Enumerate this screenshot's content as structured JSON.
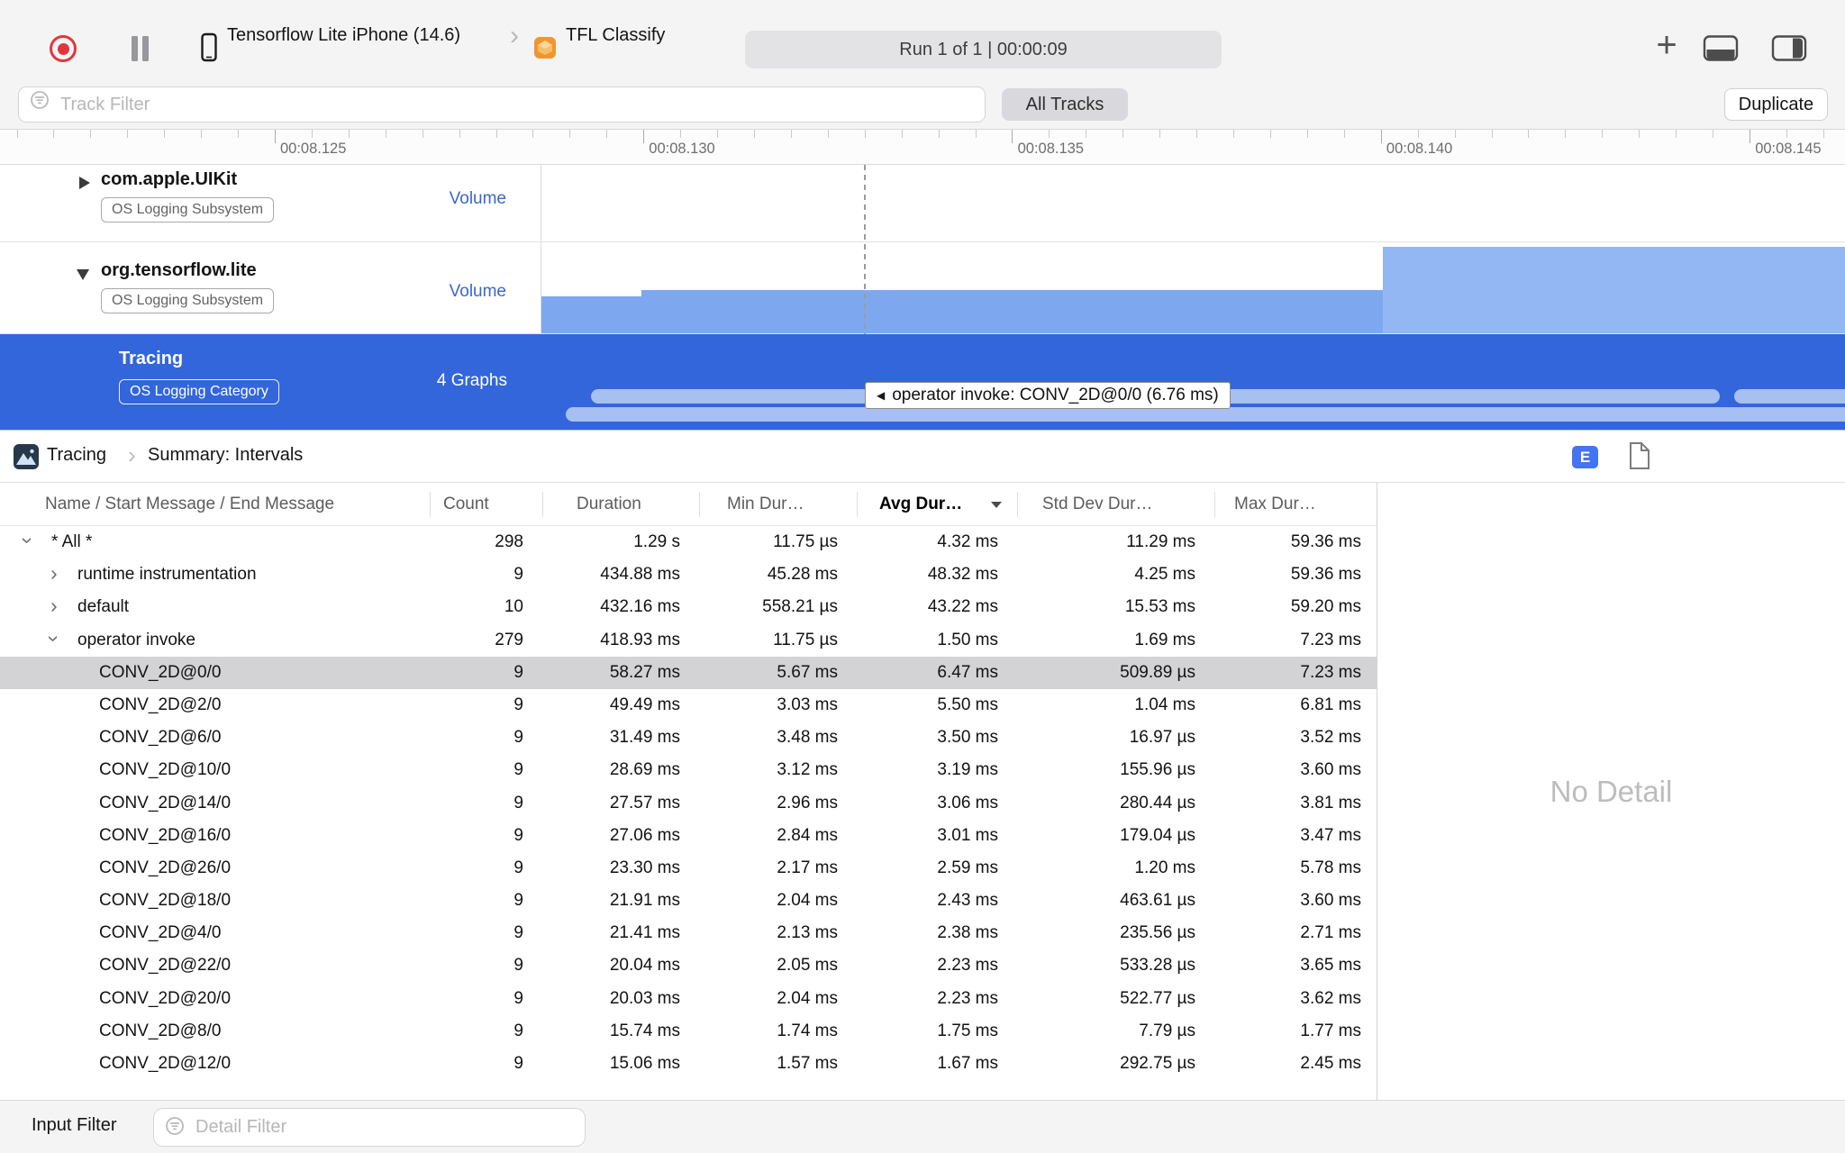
{
  "toolbar": {
    "device": "Tensorflow Lite iPhone (14.6)",
    "app": "TFL Classify",
    "run_status": "Run 1 of 1  |  00:00:09",
    "plus": "+"
  },
  "filter_bar": {
    "track_filter_placeholder": "Track Filter",
    "all_tracks": "All Tracks",
    "duplicate": "Duplicate"
  },
  "ruler": {
    "labels": [
      "00:08.125",
      "00:08.130",
      "00:08.135",
      "00:08.140",
      "00:08.145"
    ]
  },
  "tracks": [
    {
      "name": "com.apple.UIKit",
      "badge": "OS Logging Subsystem",
      "meta": "Volume",
      "disclosure": "collapsed",
      "selected": false
    },
    {
      "name": "org.tensorflow.lite",
      "badge": "OS Logging Subsystem",
      "meta": "Volume",
      "disclosure": "expanded",
      "selected": false
    },
    {
      "name": "Tracing",
      "badge": "OS Logging Category",
      "meta": "4 Graphs",
      "disclosure": "none",
      "selected": true
    }
  ],
  "tooltip": {
    "text": "operator invoke: CONV_2D@0/0 (6.76 ms)"
  },
  "detail_header": {
    "breadcrumb_root": "Tracing",
    "breadcrumb_current": "Summary: Intervals",
    "events_button": "E"
  },
  "table": {
    "columns": [
      "Name / Start Message / End Message",
      "Count",
      "Duration",
      "Min Dur…",
      "Avg Dur…",
      "Std Dev Dur…",
      "Max Dur…"
    ],
    "sorted_column": "Avg Dur…",
    "rows": [
      {
        "name": "* All *",
        "level": 0,
        "disclosure": "expanded",
        "selected": false,
        "count": "298",
        "duration": "1.29 s",
        "min": "11.75 µs",
        "avg": "4.32 ms",
        "std_dev": "11.29 ms",
        "max": "59.36 ms"
      },
      {
        "name": "runtime instrumentation",
        "level": 1,
        "disclosure": "collapsed",
        "selected": false,
        "count": "9",
        "duration": "434.88 ms",
        "min": "45.28 ms",
        "avg": "48.32 ms",
        "std_dev": "4.25 ms",
        "max": "59.36 ms"
      },
      {
        "name": "default",
        "level": 1,
        "disclosure": "collapsed",
        "selected": false,
        "count": "10",
        "duration": "432.16 ms",
        "min": "558.21 µs",
        "avg": "43.22 ms",
        "std_dev": "15.53 ms",
        "max": "59.20 ms"
      },
      {
        "name": "operator invoke",
        "level": 1,
        "disclosure": "expanded",
        "selected": false,
        "count": "279",
        "duration": "418.93 ms",
        "min": "11.75 µs",
        "avg": "1.50 ms",
        "std_dev": "1.69 ms",
        "max": "7.23 ms"
      },
      {
        "name": "CONV_2D@0/0",
        "level": 2,
        "disclosure": null,
        "selected": true,
        "count": "9",
        "duration": "58.27 ms",
        "min": "5.67 ms",
        "avg": "6.47 ms",
        "std_dev": "509.89 µs",
        "max": "7.23 ms"
      },
      {
        "name": "CONV_2D@2/0",
        "level": 2,
        "disclosure": null,
        "selected": false,
        "count": "9",
        "duration": "49.49 ms",
        "min": "3.03 ms",
        "avg": "5.50 ms",
        "std_dev": "1.04 ms",
        "max": "6.81 ms"
      },
      {
        "name": "CONV_2D@6/0",
        "level": 2,
        "disclosure": null,
        "selected": false,
        "count": "9",
        "duration": "31.49 ms",
        "min": "3.48 ms",
        "avg": "3.50 ms",
        "std_dev": "16.97 µs",
        "max": "3.52 ms"
      },
      {
        "name": "CONV_2D@10/0",
        "level": 2,
        "disclosure": null,
        "selected": false,
        "count": "9",
        "duration": "28.69 ms",
        "min": "3.12 ms",
        "avg": "3.19 ms",
        "std_dev": "155.96 µs",
        "max": "3.60 ms"
      },
      {
        "name": "CONV_2D@14/0",
        "level": 2,
        "disclosure": null,
        "selected": false,
        "count": "9",
        "duration": "27.57 ms",
        "min": "2.96 ms",
        "avg": "3.06 ms",
        "std_dev": "280.44 µs",
        "max": "3.81 ms"
      },
      {
        "name": "CONV_2D@16/0",
        "level": 2,
        "disclosure": null,
        "selected": false,
        "count": "9",
        "duration": "27.06 ms",
        "min": "2.84 ms",
        "avg": "3.01 ms",
        "std_dev": "179.04 µs",
        "max": "3.47 ms"
      },
      {
        "name": "CONV_2D@26/0",
        "level": 2,
        "disclosure": null,
        "selected": false,
        "count": "9",
        "duration": "23.30 ms",
        "min": "2.17 ms",
        "avg": "2.59 ms",
        "std_dev": "1.20 ms",
        "max": "5.78 ms"
      },
      {
        "name": "CONV_2D@18/0",
        "level": 2,
        "disclosure": null,
        "selected": false,
        "count": "9",
        "duration": "21.91 ms",
        "min": "2.04 ms",
        "avg": "2.43 ms",
        "std_dev": "463.61 µs",
        "max": "3.60 ms"
      },
      {
        "name": "CONV_2D@4/0",
        "level": 2,
        "disclosure": null,
        "selected": false,
        "count": "9",
        "duration": "21.41 ms",
        "min": "2.13 ms",
        "avg": "2.38 ms",
        "std_dev": "235.56 µs",
        "max": "2.71 ms"
      },
      {
        "name": "CONV_2D@22/0",
        "level": 2,
        "disclosure": null,
        "selected": false,
        "count": "9",
        "duration": "20.04 ms",
        "min": "2.05 ms",
        "avg": "2.23 ms",
        "std_dev": "533.28 µs",
        "max": "3.65 ms"
      },
      {
        "name": "CONV_2D@20/0",
        "level": 2,
        "disclosure": null,
        "selected": false,
        "count": "9",
        "duration": "20.03 ms",
        "min": "2.04 ms",
        "avg": "2.23 ms",
        "std_dev": "522.77 µs",
        "max": "3.62 ms"
      },
      {
        "name": "CONV_2D@8/0",
        "level": 2,
        "disclosure": null,
        "selected": false,
        "count": "9",
        "duration": "15.74 ms",
        "min": "1.74 ms",
        "avg": "1.75 ms",
        "std_dev": "7.79 µs",
        "max": "1.77 ms"
      },
      {
        "name": "CONV_2D@12/0",
        "level": 2,
        "disclosure": null,
        "selected": false,
        "count": "9",
        "duration": "15.06 ms",
        "min": "1.57 ms",
        "avg": "1.67 ms",
        "std_dev": "292.75 µs",
        "max": "2.45 ms"
      }
    ]
  },
  "detail_panel": {
    "empty_text": "No Detail"
  },
  "bottom_bar": {
    "input_filter_label": "Input Filter",
    "detail_filter_placeholder": "Detail Filter"
  },
  "colors": {
    "accent_blue": "#3366DB",
    "graph_blue": "#7DA8F0",
    "record_red": "#DE383C",
    "selected_row_gray": "#D3D3D5"
  }
}
